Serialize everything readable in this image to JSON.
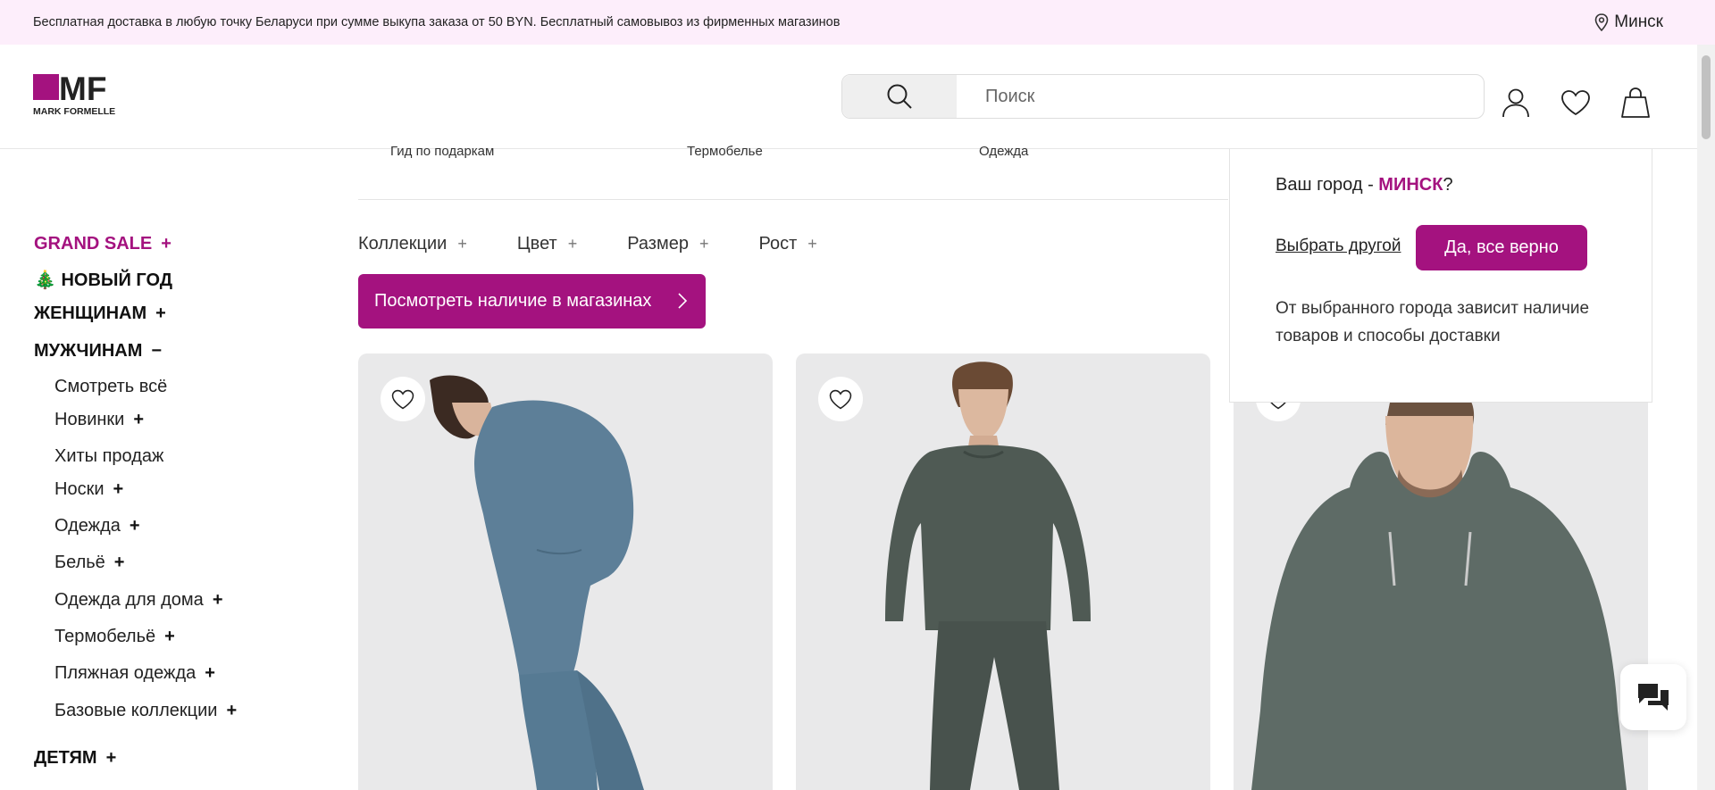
{
  "topbar": {
    "notice": "Бесплатная доставка в любую точку Беларуси при сумме выкупа заказа от 50 BYN. Бесплатный самовывоз из фирменных магазинов",
    "city": "Минск",
    "bg_color": "#fdeefb"
  },
  "header": {
    "logo_letters": "MF",
    "logo_text": "MARK FORMELLE",
    "search_placeholder": "Поиск",
    "icons": [
      "search-icon",
      "user-icon",
      "heart-icon",
      "bag-icon"
    ]
  },
  "subcategories": [
    "Гид по подаркам",
    "Термобелье",
    "Одежда"
  ],
  "sidebar": {
    "top_items": [
      {
        "label": "GRAND SALE",
        "sign": "+"
      },
      {
        "label": "🎄 НОВЫЙ ГОД",
        "sign": ""
      },
      {
        "label": "ЖЕНЩИНАМ",
        "sign": "+"
      },
      {
        "label": "МУЖЧИНАМ",
        "sign": "−"
      },
      {
        "label": "ДЕТЯМ",
        "sign": "+"
      }
    ],
    "men_items": [
      {
        "label": "Смотреть всё",
        "sign": ""
      },
      {
        "label": "Новинки",
        "sign": "+"
      },
      {
        "label": "Хиты продаж",
        "sign": ""
      },
      {
        "label": "Носки",
        "sign": "+"
      },
      {
        "label": "Одежда",
        "sign": "+"
      },
      {
        "label": "Бельё",
        "sign": "+"
      },
      {
        "label": "Одежда для дома",
        "sign": "+"
      },
      {
        "label": "Термобельё",
        "sign": "+"
      },
      {
        "label": "Пляжная одежда",
        "sign": "+"
      },
      {
        "label": "Базовые коллекции",
        "sign": "+"
      }
    ]
  },
  "filters": [
    {
      "label": "Коллекции",
      "sign": "+"
    },
    {
      "label": "Цвет",
      "sign": "+"
    },
    {
      "label": "Размер",
      "sign": "+"
    },
    {
      "label": "Рост",
      "sign": "+"
    }
  ],
  "availability_button": "Посмотреть наличие в магазинах",
  "products": [
    {
      "color": "#5d7f98",
      "desc": "blue hoodie and joggers"
    },
    {
      "color": "#4f5a54",
      "desc": "dark green sweatshirt and pants"
    },
    {
      "color": "#5e6b66",
      "desc": "green hoodie"
    }
  ],
  "city_popup": {
    "question_prefix": "Ваш город - ",
    "city": "МИНСК",
    "question_suffix": "?",
    "choose_other": "Выбрать другой",
    "confirm": "Да, все верно",
    "note": "От выбранного города зависит наличие товаров и способы доставки"
  },
  "colors": {
    "accent": "#a4127f",
    "text": "#222222"
  }
}
